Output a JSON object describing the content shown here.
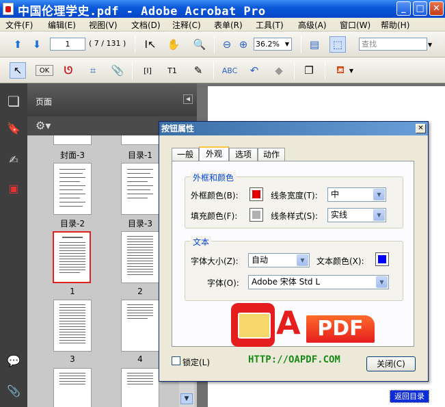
{
  "window": {
    "title": "中国伦理学史.pdf - Adobe Acrobat Pro",
    "minimize": "_",
    "maximize": "□",
    "close": "✕"
  },
  "menu": [
    "文件(F)",
    "编辑(E)",
    "视图(V)",
    "文档(D)",
    "注释(C)",
    "表单(R)",
    "工具(T)",
    "高级(A)",
    "窗口(W)",
    "帮助(H)"
  ],
  "toolbar": {
    "page_input": "1",
    "page_count": "( 7 / 131 )",
    "zoom": "36.2%",
    "search_placeholder": "查找"
  },
  "nav": {
    "header": "页面",
    "thumbs": [
      {
        "label": "封面-3"
      },
      {
        "label": "目录-1"
      },
      {
        "label": "目录-2"
      },
      {
        "label": "目录-3"
      },
      {
        "label": "1"
      },
      {
        "label": "2"
      },
      {
        "label": "3"
      },
      {
        "label": "4"
      }
    ]
  },
  "document": {
    "link_button": "返回目录"
  },
  "dialog": {
    "title": "按钮属性",
    "tabs": [
      "一般",
      "外观",
      "选项",
      "动作"
    ],
    "active_tab": "外观",
    "border_group": {
      "title": "外框和颜色",
      "border_color_label": "外框颜色(B):",
      "fill_color_label": "填充颜色(F):",
      "line_width_label": "线条宽度(T):",
      "line_width_value": "中",
      "line_style_label": "线条样式(S):",
      "line_style_value": "实线"
    },
    "text_group": {
      "title": "文本",
      "font_size_label": "字体大小(Z):",
      "font_size_value": "自动",
      "text_color_label": "文本颜色(X):",
      "font_label": "字体(O):",
      "font_value": "Adobe 宋体 Std L"
    },
    "logo": {
      "letter": "A",
      "text": "PDF"
    },
    "url": "HTTP://OAPDF.COM",
    "lock_label": "锁定(L)",
    "close_button": "关闭(C)",
    "colors": {
      "border": "#e00000",
      "fill": "#b0b0b0",
      "text": "#0000ff"
    }
  }
}
